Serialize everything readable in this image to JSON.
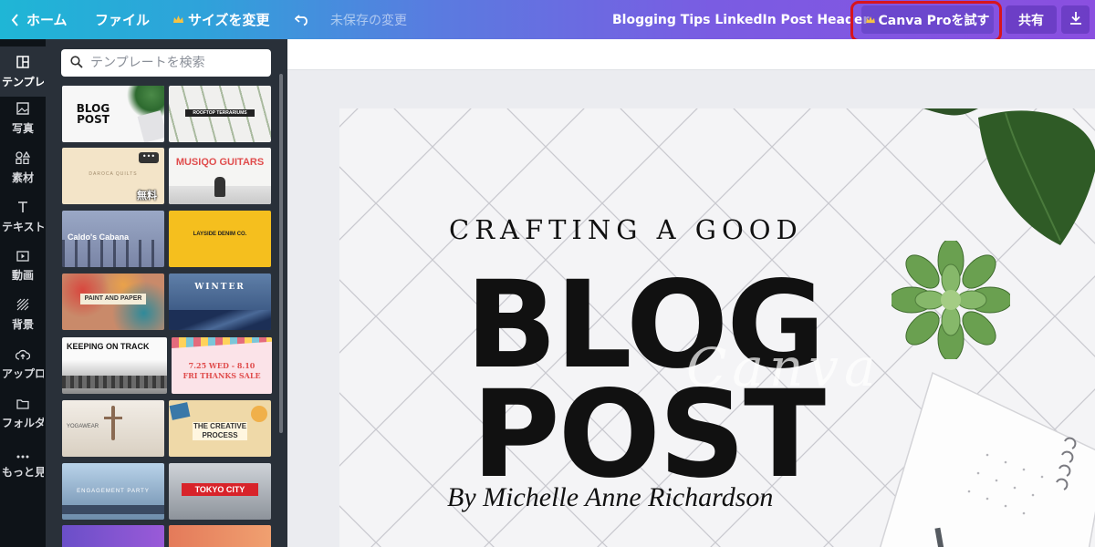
{
  "topbar": {
    "home_label": "ホーム",
    "file_label": "ファイル",
    "resize_label": "サイズを変更",
    "unsaved_label": "未保存の変更",
    "doc_title": "Blogging Tips LinkedIn Post Header",
    "pro_button_label": "Canva Proを試す",
    "share_label": "共有",
    "accent_colors": [
      "#1fb6d6",
      "#5a7be0",
      "#8a4fe0"
    ],
    "annotation_color": "#d8141c"
  },
  "rail": {
    "items": [
      {
        "label": "テンプレート",
        "icon": "template-icon"
      },
      {
        "label": "写真",
        "icon": "photo-icon"
      },
      {
        "label": "素材",
        "icon": "elements-icon"
      },
      {
        "label": "テキスト",
        "icon": "text-icon"
      },
      {
        "label": "動画",
        "icon": "video-icon"
      },
      {
        "label": "背景",
        "icon": "background-icon"
      },
      {
        "label": "アップロード",
        "icon": "upload-icon"
      },
      {
        "label": "フォルダ",
        "icon": "folder-icon"
      },
      {
        "label": "もっと見る",
        "icon": "more-icon"
      }
    ]
  },
  "panel": {
    "search_placeholder": "テンプレートを検索",
    "templates": [
      {
        "label": "BLOG POST"
      },
      {
        "label": "ROOFTOP TERRARIUMS"
      },
      {
        "label": "DAROCA QUILTS",
        "badge": "無料"
      },
      {
        "label": "MUSIQO GUITARS"
      },
      {
        "label": "Caldo's Cabana"
      },
      {
        "label": "LAYSIDE DENIM CO."
      },
      {
        "label": "PAINT AND PAPER"
      },
      {
        "label": "WINTER"
      },
      {
        "label": "KEEPING ON TRACK"
      },
      {
        "label": "7.25 WED - 8.10 FRI THANKS SALE"
      },
      {
        "label": "YOGAWEAR"
      },
      {
        "label": "THE CREATIVE PROCESS"
      },
      {
        "label": "ENGAGEMENT PARTY"
      },
      {
        "label": "TOKYO CITY"
      }
    ]
  },
  "design": {
    "kicker": "CRAFTING A GOOD",
    "title_line1": "BLOG",
    "title_line2": "POST",
    "byline": "By Michelle Anne Richardson",
    "watermark": "Canva"
  }
}
